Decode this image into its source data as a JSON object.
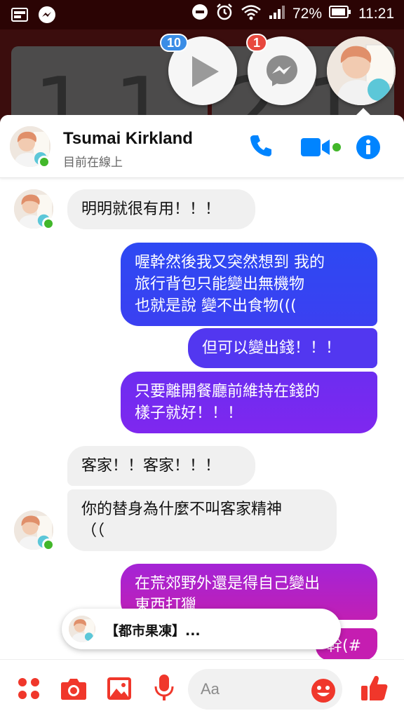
{
  "status_bar": {
    "battery": "72%",
    "time": "11:21",
    "icons": [
      "gallery-icon",
      "messenger-icon",
      "dnd-icon",
      "alarm-icon",
      "wifi-icon",
      "signal-icon",
      "battery-icon"
    ]
  },
  "chat_heads": [
    {
      "icon": "play-icon",
      "badge": "10"
    },
    {
      "icon": "messenger-icon",
      "badge": "1"
    },
    {
      "icon": "avatar"
    }
  ],
  "header": {
    "name": "Tsumai Kirkland",
    "status": "目前在線上",
    "icons": [
      "phone-icon",
      "video-icon",
      "info-icon"
    ]
  },
  "messages": [
    {
      "dir": "in",
      "text": "明明就很有用！！！"
    },
    {
      "dir": "out",
      "text": "喔幹然後我又突然想到 我的\n旅行背包只能變出無機物\n也就是說 變不出食物((("
    },
    {
      "dir": "out",
      "text": "但可以變出錢！！！"
    },
    {
      "dir": "out",
      "text": "只要離開餐廳前維持在錢的\n樣子就好！！！"
    },
    {
      "dir": "in",
      "text": "客家！！客家！！！"
    },
    {
      "dir": "in",
      "text": "你的替身為什麼不叫客家精神\n（（"
    },
    {
      "dir": "out",
      "text": "在荒郊野外還是得自己變出\n東西打獵"
    },
    {
      "dir": "out",
      "text": "幹(#"
    }
  ],
  "notification": {
    "text": "【都市果凍】..."
  },
  "composer": {
    "placeholder": "Aa",
    "icons": [
      "apps-icon",
      "camera-icon",
      "gallery-icon",
      "microphone-icon",
      "emoji-icon",
      "thumbs-up-icon"
    ]
  },
  "colors": {
    "accent": "#0084ff",
    "composer_red": "#f0372b",
    "presence": "#42b72a",
    "gradient_top": "#2f45f2",
    "gradient_mid": "#7f2bf0",
    "gradient_bottom": "#c61db4"
  }
}
